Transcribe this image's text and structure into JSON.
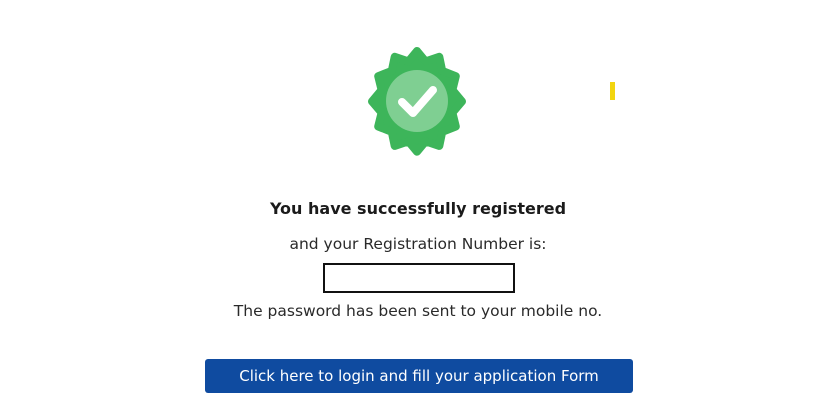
{
  "success": {
    "icon": "check-badge-icon",
    "colors": {
      "badge": "#3db55a",
      "inner_circle": "#7fcf92",
      "check": "#ffffff"
    }
  },
  "messages": {
    "title": "You have successfully registered",
    "subtitle": "and your Registration Number is:",
    "registration_number": "",
    "password_note": "The password has been sent to your mobile no."
  },
  "actions": {
    "login_label": "Click here to login and fill your application Form",
    "button_color": "#0f4ba0"
  }
}
